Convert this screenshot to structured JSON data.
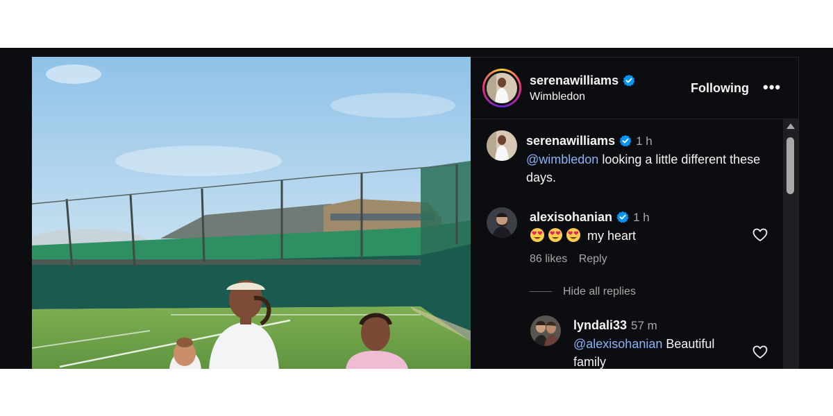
{
  "post": {
    "username": "serenawilliams",
    "location": "Wimbledon",
    "follow_status": "Following",
    "more_label": "•••"
  },
  "caption": {
    "username": "serenawilliams",
    "time": "1 h",
    "mention": "@wimbledon",
    "text": " looking a little different these days."
  },
  "comments": [
    {
      "username": "alexisohanian",
      "time": "1 h",
      "emoji": [
        "smiling-face-with-heart-eyes",
        "smiling-face-with-heart-eyes",
        "smiling-face-with-heart-eyes"
      ],
      "text": "my heart",
      "likes": "86 likes",
      "reply_label": "Reply",
      "toggle_replies": "Hide all replies"
    }
  ],
  "replies": [
    {
      "username": "lyndali33",
      "time": "57 m",
      "mention": "@alexisohanian",
      "text": " Beautiful family"
    }
  ],
  "colors": {
    "background": "#0c0d11",
    "text": "#f5f5f5",
    "secondary_text": "#a8a8a8",
    "mention": "#8ab4f8",
    "verified": "#0095f6"
  },
  "icons": [
    "verified-badge-icon",
    "heart-icon",
    "chevron-left-icon",
    "more-options-icon"
  ]
}
